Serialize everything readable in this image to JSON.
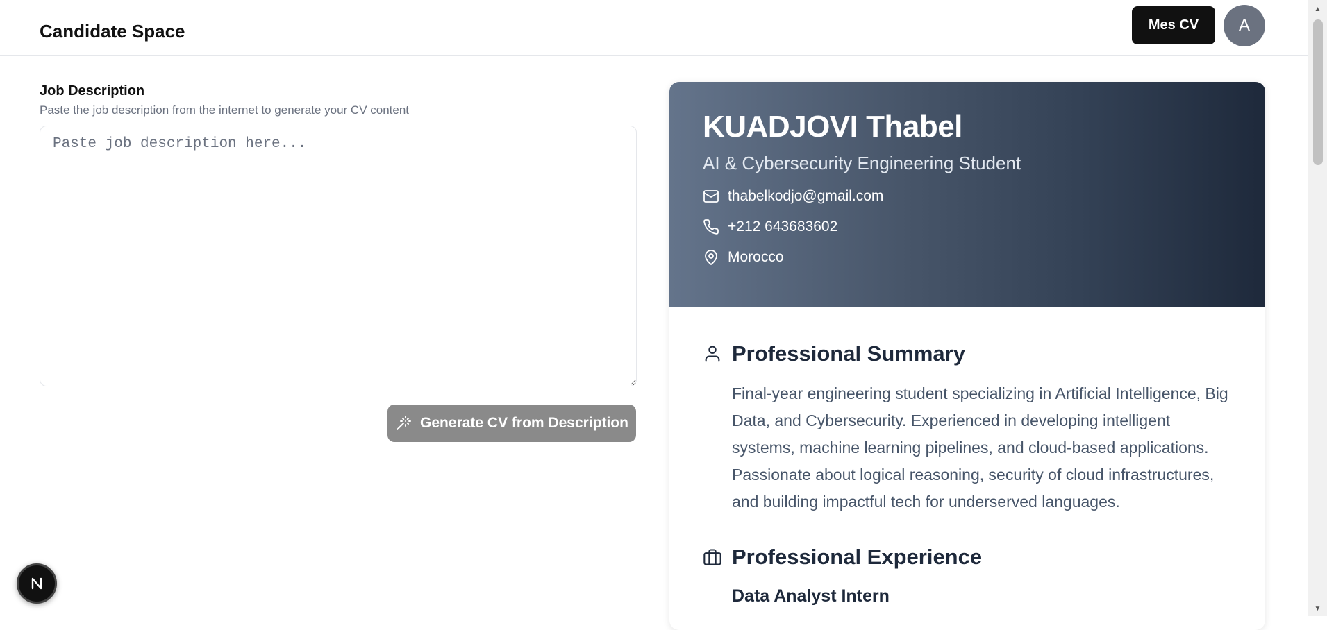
{
  "header": {
    "title": "Candidate Space",
    "my_cv_button": "Mes CV",
    "avatar_initial": "A"
  },
  "job_description": {
    "label": "Job Description",
    "help": "Paste the job description from the internet to generate your CV content",
    "placeholder": "Paste job description here...",
    "value": "",
    "generate_button": "Generate CV from Description"
  },
  "cv": {
    "name": "KUADJOVI Thabel",
    "title": "AI & Cybersecurity Engineering Student",
    "email": "thabelkodjo@gmail.com",
    "phone": "+212 643683602",
    "location": "Morocco",
    "summary_title": "Professional Summary",
    "summary": "Final-year engineering student specializing in Artificial Intelligence, Big Data, and Cybersecurity. Experienced in developing intelligent systems, machine learning pipelines, and cloud-based applications. Passionate about logical reasoning, security of cloud infrastructures, and building impactful tech for underserved languages.",
    "experience_title": "Professional Experience",
    "experience_first_role": "Data Analyst Intern"
  },
  "fab_label": "N",
  "colors": {
    "hero_gradient_start": "#64748b",
    "hero_gradient_end": "#1e293b",
    "primary_button": "#111111",
    "generate_button_disabled": "#8a8a8a"
  }
}
